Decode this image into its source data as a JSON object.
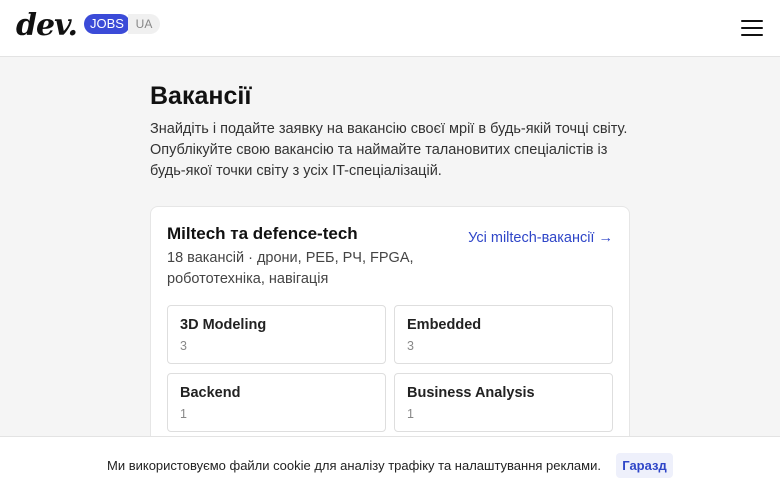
{
  "header": {
    "logo_text": "dev.",
    "jobs_label": "JOBS",
    "lang_label": "UA",
    "menu_icon": "hamburger-menu-icon"
  },
  "main": {
    "title": "Вакансії",
    "intro": "Знайдіть і подайте заявку на вакансію своєї мрії в будь-якій точці світу. Опублікуйте свою вакансію та наймайте талановитих спеціалістів із будь-якої точки світу з усіх IT-спеціалізацій."
  },
  "section": {
    "title": "Miltech та defence-tech",
    "subtitle": "18 вакансій · дрони, РЕБ, РЧ, FPGA, робототехніка, навігація",
    "link": "Усі miltech-вакансії →",
    "tiles": [
      {
        "name": "3D Modeling",
        "count": "3"
      },
      {
        "name": "Embedded",
        "count": "3"
      },
      {
        "name": "Backend",
        "count": "1"
      },
      {
        "name": "Business Analysis",
        "count": "1"
      }
    ]
  },
  "cookie": {
    "text": "Ми використовуємо файли cookie для аналізу трафіку та налаштування реклами.",
    "button": "Гаразд"
  },
  "colors": {
    "accent": "#3b4bd8",
    "link": "#2f46c8",
    "background": "#f5f5f5"
  }
}
